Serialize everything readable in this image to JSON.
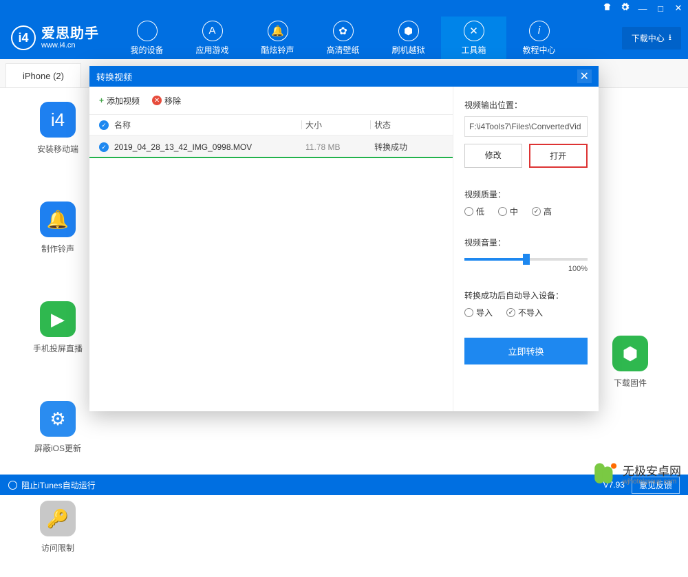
{
  "app": {
    "name": "爱思助手",
    "url": "www.i4.cn"
  },
  "win_controls": {
    "settings": "⚙",
    "min": "—",
    "max": "□",
    "close": "✕"
  },
  "nav": [
    {
      "label": "我的设备"
    },
    {
      "label": "应用游戏"
    },
    {
      "label": "酷炫铃声"
    },
    {
      "label": "高清壁纸"
    },
    {
      "label": "刷机越狱"
    },
    {
      "label": "工具箱"
    },
    {
      "label": "教程中心"
    }
  ],
  "download_center": "下载中心",
  "tab": {
    "label": "iPhone (2)"
  },
  "tools_left": [
    {
      "label": "安装移动端"
    },
    {
      "label": "制作铃声"
    },
    {
      "label": "手机投屏直播"
    },
    {
      "label": "屏蔽iOS更新"
    },
    {
      "label": "访问限制"
    }
  ],
  "tool_right": {
    "label": "下载固件"
  },
  "modal": {
    "title": "转换视频",
    "add": "添加视频",
    "remove": "移除",
    "columns": {
      "name": "名称",
      "size": "大小",
      "status": "状态"
    },
    "row": {
      "name": "2019_04_28_13_42_IMG_0998.MOV",
      "size": "11.78 MB",
      "status": "转换成功",
      "progress_pct": 100
    },
    "output_label": "视频输出位置：",
    "output_path": "F:\\i4Tools7\\Files\\ConvertedVid",
    "modify": "修改",
    "open": "打开",
    "quality_label": "视频质量：",
    "quality_opts": {
      "low": "低",
      "mid": "中",
      "high": "高"
    },
    "volume_label": "视频音量：",
    "volume_val": "100%",
    "volume_pct": 50,
    "autoimport_label": "转换成功后自动导入设备：",
    "autoimport_opts": {
      "yes": "导入",
      "no": "不导入"
    },
    "convert_btn": "立即转换"
  },
  "statusbar": {
    "block_itunes": "阻止iTunes自动运行",
    "version": "V7.93",
    "feedback": "意见反馈"
  },
  "watermark": {
    "line1": "无极安卓网",
    "line2": "wjhotelgroup.com"
  }
}
